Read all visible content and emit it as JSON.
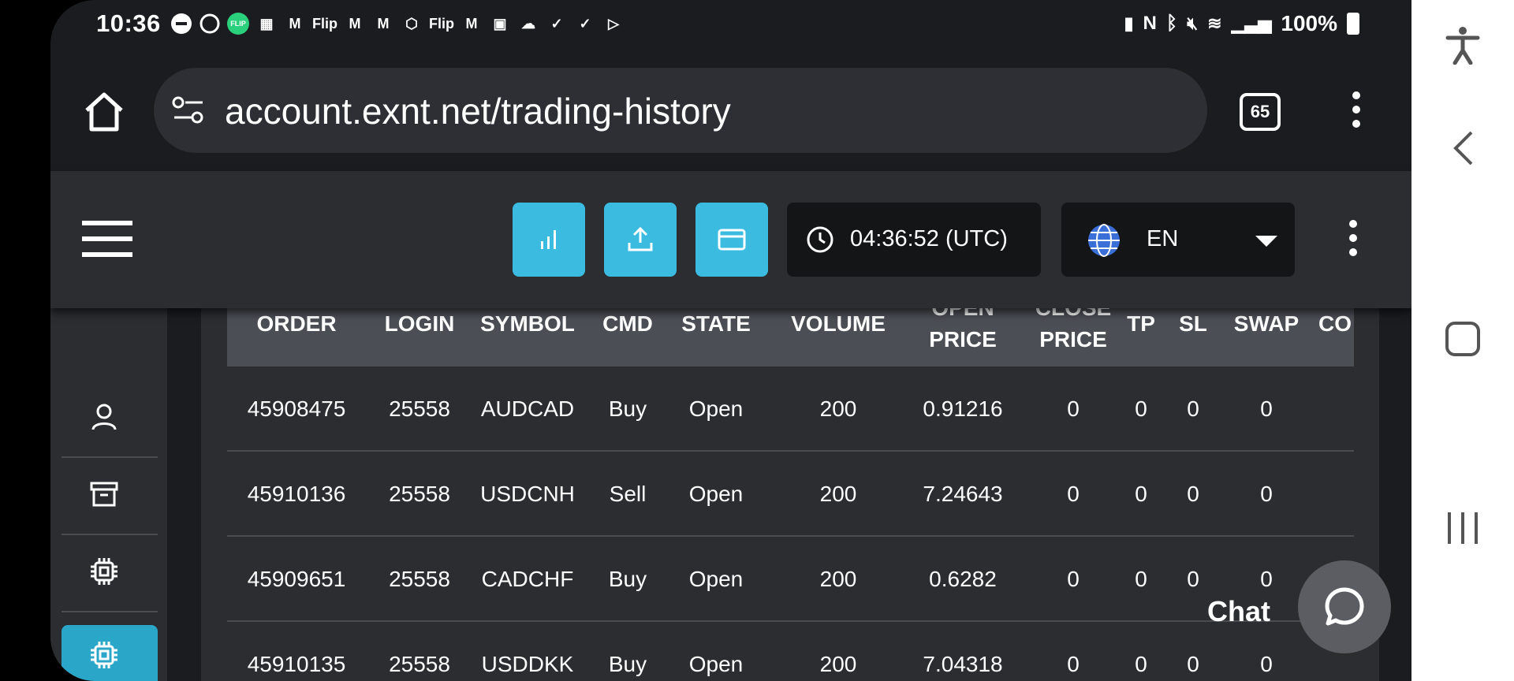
{
  "status_bar": {
    "time": "10:36",
    "notification_labels": [
      "FLIP",
      "Flip",
      "Flip"
    ],
    "battery": "100%"
  },
  "browser": {
    "url": "account.exnt.net/trading-history",
    "tab_count": "65"
  },
  "app_bar": {
    "clock": "04:36:52 (UTC)",
    "language": "EN"
  },
  "table": {
    "columns": [
      {
        "line1": "ORDER",
        "line2": ""
      },
      {
        "line1": "LOGIN",
        "line2": ""
      },
      {
        "line1": "SYMBOL",
        "line2": ""
      },
      {
        "line1": "CMD",
        "line2": ""
      },
      {
        "line1": "STATE",
        "line2": ""
      },
      {
        "line1": "VOLUME",
        "line2": ""
      },
      {
        "line1": "OPEN",
        "line2": "PRICE"
      },
      {
        "line1": "CLOSE",
        "line2": "PRICE"
      },
      {
        "line1": "TP",
        "line2": ""
      },
      {
        "line1": "SL",
        "line2": ""
      },
      {
        "line1": "SWAP",
        "line2": ""
      },
      {
        "line1": "CO",
        "line2": ""
      }
    ],
    "rows": [
      {
        "order": "45908475",
        "login": "25558",
        "symbol": "AUDCAD",
        "cmd": "Buy",
        "state": "Open",
        "volume": "200",
        "open_price": "0.91216",
        "close_price": "0",
        "tp": "0",
        "sl": "0",
        "swap": "0"
      },
      {
        "order": "45910136",
        "login": "25558",
        "symbol": "USDCNH",
        "cmd": "Sell",
        "state": "Open",
        "volume": "200",
        "open_price": "7.24643",
        "close_price": "0",
        "tp": "0",
        "sl": "0",
        "swap": "0"
      },
      {
        "order": "45909651",
        "login": "25558",
        "symbol": "CADCHF",
        "cmd": "Buy",
        "state": "Open",
        "volume": "200",
        "open_price": "0.6282",
        "close_price": "0",
        "tp": "0",
        "sl": "0",
        "swap": "0"
      },
      {
        "order": "45910135",
        "login": "25558",
        "symbol": "USDDKK",
        "cmd": "Buy",
        "state": "Open",
        "volume": "200",
        "open_price": "7.04318",
        "close_price": "0",
        "tp": "0",
        "sl": "0",
        "swap": "0"
      }
    ]
  },
  "chat": {
    "label": "Chat"
  },
  "sidebar": {
    "icons": [
      "user-icon",
      "archive-icon",
      "chip-icon",
      "chip-icon"
    ]
  },
  "colors": {
    "accent": "#3cbbe0",
    "active_sidebar": "#2aa6c9",
    "panel": "#2b2d31",
    "table_header": "#4b4e55"
  }
}
